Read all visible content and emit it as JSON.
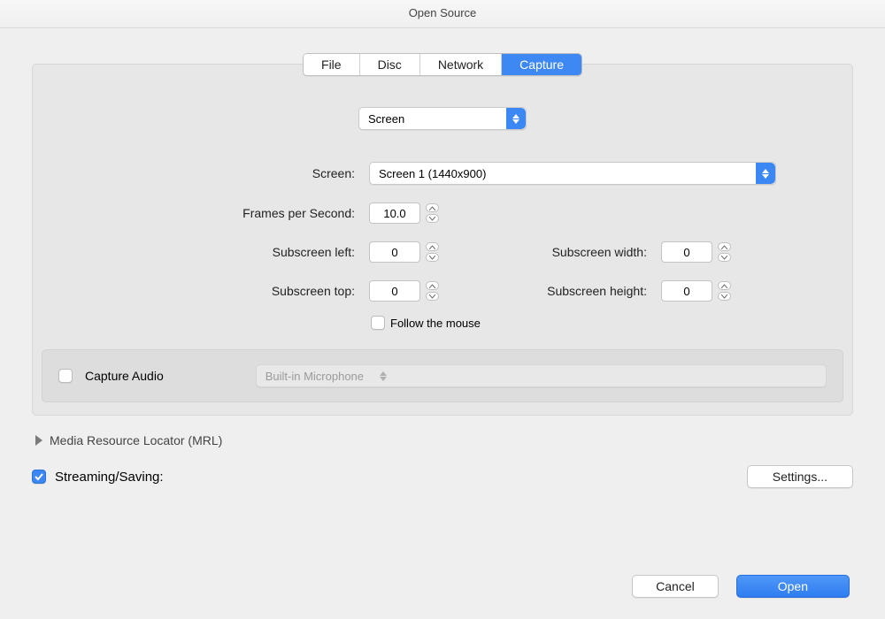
{
  "title": "Open Source",
  "tabs": {
    "file": "File",
    "disc": "Disc",
    "network": "Network",
    "capture": "Capture"
  },
  "capture_source": "Screen",
  "labels": {
    "screen": "Screen:",
    "fps": "Frames per Second:",
    "subleft": "Subscreen left:",
    "subwidth": "Subscreen width:",
    "subtop": "Subscreen top:",
    "subheight": "Subscreen height:",
    "follow": "Follow the mouse",
    "capture_audio": "Capture Audio",
    "mrl": "Media Resource Locator (MRL)",
    "streaming": "Streaming/Saving:"
  },
  "values": {
    "screen": "Screen 1 (1440x900)",
    "fps": "10.0",
    "subleft": "0",
    "subwidth": "0",
    "subtop": "0",
    "subheight": "0",
    "audio_device": "Built-in Microphone"
  },
  "buttons": {
    "settings": "Settings...",
    "cancel": "Cancel",
    "open": "Open"
  }
}
